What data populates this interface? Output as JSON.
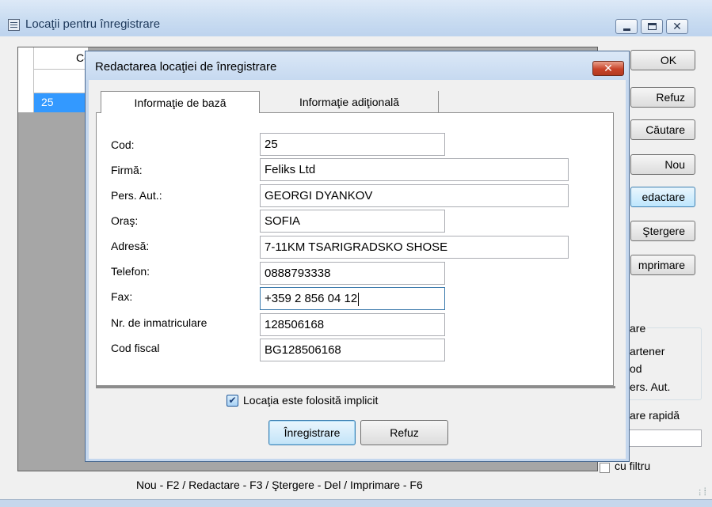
{
  "main_window": {
    "title": "Locaţii pentru înregistrare",
    "grid": {
      "column_header": "Co",
      "selected_row_value": "25"
    },
    "side_buttons": [
      "OK",
      "Refuz",
      "Căutare",
      "Nou",
      "edactare",
      "Ştergere",
      "mprimare"
    ],
    "group_title": "are",
    "group_options": [
      "artener",
      "od",
      "ers. Aut."
    ],
    "quick_search_label": "are rapidă",
    "filter_label": "cu filtru",
    "status_bar": "Nou - F2 / Redactare - F3 / Ştergere - Del / Imprimare - F6"
  },
  "dialog": {
    "title": "Redactarea locaţiei de înregistrare",
    "tabs": [
      "Informaţie de bază",
      "Informaţie adiţională"
    ],
    "active_tab": "Informaţie de bază",
    "fields": {
      "cod": {
        "label": "Cod:",
        "value": "25"
      },
      "firma": {
        "label": "Firmă:",
        "value": "Feliks Ltd"
      },
      "pers_aut": {
        "label": "Pers. Aut.:",
        "value": "GEORGI DYANKOV"
      },
      "oras": {
        "label": "Oraş:",
        "value": "SOFIA"
      },
      "adresa": {
        "label": "Adresă:",
        "value": "7-11KM TSARIGRADSKO SHOSE"
      },
      "telefon": {
        "label": "Telefon:",
        "value": "0888793338"
      },
      "fax": {
        "label": "Fax:",
        "value": "+359 2 856 04 12"
      },
      "nr_inmatriculare": {
        "label": "Nr. de inmatriculare",
        "value": "128506168"
      },
      "cod_fiscal": {
        "label": "Cod fiscal",
        "value": "BG128506168"
      }
    },
    "default_checkbox": {
      "label": "Locaţia este folosită implicit",
      "checked": true
    },
    "save_label": "Înregistrare",
    "cancel_label": "Refuz"
  },
  "colors": {
    "selection": "#3399ff",
    "close_button": "#c8442a",
    "titlebar": "#c9dcf1"
  }
}
